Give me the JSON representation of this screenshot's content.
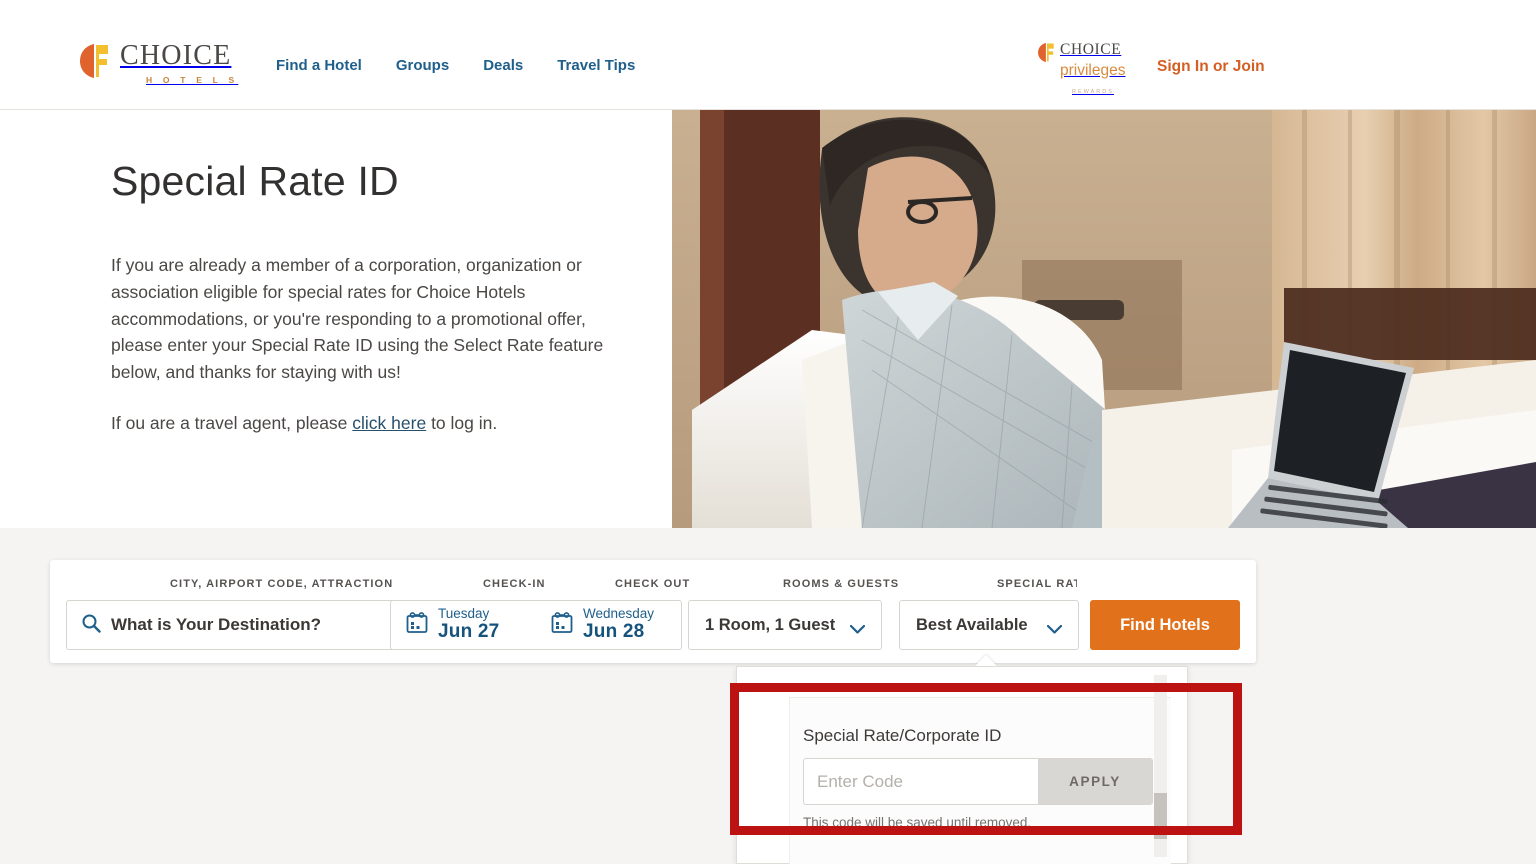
{
  "header": {
    "logo": {
      "word": "CHOICE",
      "sub": "H O T E L S"
    },
    "nav": [
      {
        "label": "Find a Hotel"
      },
      {
        "label": "Groups"
      },
      {
        "label": "Deals"
      },
      {
        "label": "Travel Tips"
      }
    ],
    "privileges": {
      "word": "CHOICE",
      "sub": "privileges",
      "rewards": "REWARDS"
    },
    "signin_label": "Sign In or Join",
    "accent_orange": "#d35f22",
    "nav_blue": "#1f5f8b"
  },
  "hero": {
    "title": "Special Rate ID",
    "paragraph1": "If you are already a member of a corporation, organization or association eligible for special rates for Choice Hotels accommodations, or you're responding to a promotional offer, please enter your Special Rate ID using the Select Rate feature below, and thanks for staying with us!",
    "paragraph2_before": "If ou are a travel agent, please ",
    "paragraph2_link": "click here",
    "paragraph2_after": " to log in."
  },
  "search": {
    "labels": {
      "destination": "CITY, AIRPORT CODE, ATTRACTION",
      "checkin": "CHECK-IN",
      "checkout": "CHECK OUT",
      "rooms": "ROOMS & GUESTS",
      "rate": "SPECIAL RATE"
    },
    "destination_placeholder": "What is Your Destination?",
    "checkin": {
      "dow": "Tuesday",
      "date": "Jun 27"
    },
    "checkout": {
      "dow": "Wednesday",
      "date": "Jun 28"
    },
    "rooms_value": "1 Room, 1 Guest",
    "rate_value": "Best Available",
    "find_button": "Find Hotels",
    "button_color": "#e2711b"
  },
  "rate_panel": {
    "title": "Special Rate/Corporate ID",
    "code_placeholder": "Enter Code",
    "code_value": "",
    "apply_label": "APPLY",
    "note": "This code will be saved until removed."
  },
  "annotation": {
    "highlight_color": "#bc1212"
  }
}
